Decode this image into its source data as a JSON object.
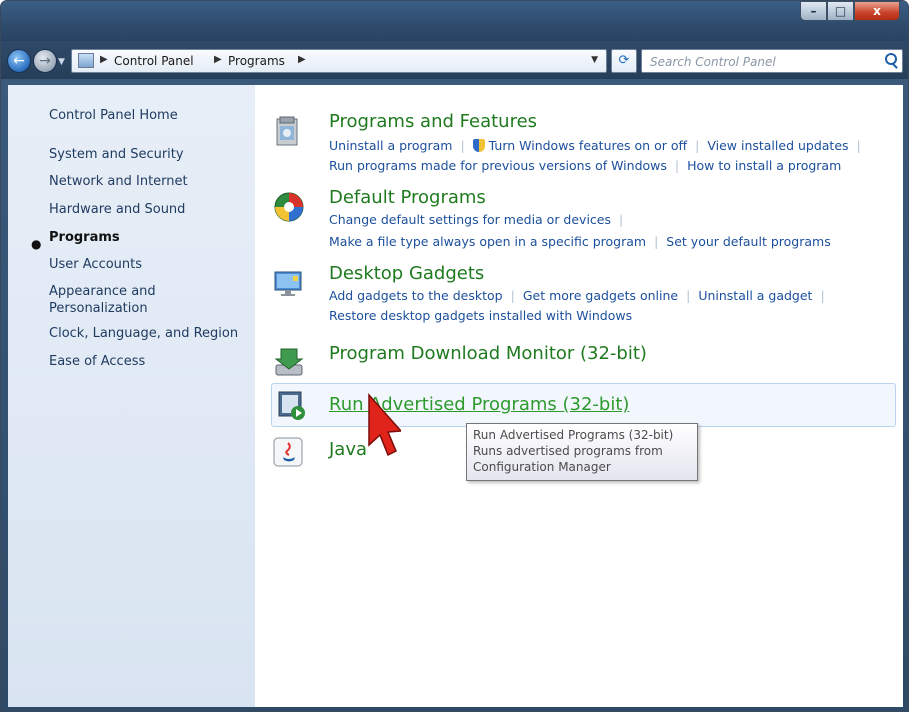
{
  "window": {
    "controls": {
      "minimize": "–",
      "maximize": "□",
      "close": "x"
    }
  },
  "nav": {
    "back_icon": "←",
    "forward_icon": "→",
    "breadcrumbs": [
      "Control Panel",
      "Programs"
    ],
    "search_placeholder": "Search Control Panel"
  },
  "sidebar": {
    "items": [
      {
        "label": "Control Panel Home"
      },
      {
        "label": "System and Security"
      },
      {
        "label": "Network and Internet"
      },
      {
        "label": "Hardware and Sound"
      },
      {
        "label": "Programs",
        "active": true
      },
      {
        "label": "User Accounts"
      },
      {
        "label": "Appearance and Personalization"
      },
      {
        "label": "Clock, Language, and Region"
      },
      {
        "label": "Ease of Access"
      }
    ]
  },
  "sections": {
    "programs_features": {
      "title": "Programs and Features",
      "links": [
        "Uninstall a program",
        "Turn Windows features on or off",
        "View installed updates",
        "Run programs made for previous versions of Windows",
        "How to install a program"
      ]
    },
    "default_programs": {
      "title": "Default Programs",
      "links": [
        "Change default settings for media or devices",
        "Make a file type always open in a specific program",
        "Set your default programs"
      ]
    },
    "desktop_gadgets": {
      "title": "Desktop Gadgets",
      "links": [
        "Add gadgets to the desktop",
        "Get more gadgets online",
        "Uninstall a gadget",
        "Restore desktop gadgets installed with Windows"
      ]
    },
    "download_monitor": {
      "title": "Program Download Monitor (32-bit)"
    },
    "run_advertised": {
      "title": "Run Advertised Programs (32-bit)"
    },
    "java": {
      "title": "Java"
    }
  },
  "tooltip": {
    "lines": [
      "Run Advertised Programs (32-bit)",
      "Runs advertised programs from",
      "Configuration Manager"
    ]
  },
  "colors": {
    "link_blue": "#1c4f9c",
    "title_green": "#1f7a1f",
    "sidebar_bg": "#dde7f3",
    "chrome": "#2f4a69"
  }
}
